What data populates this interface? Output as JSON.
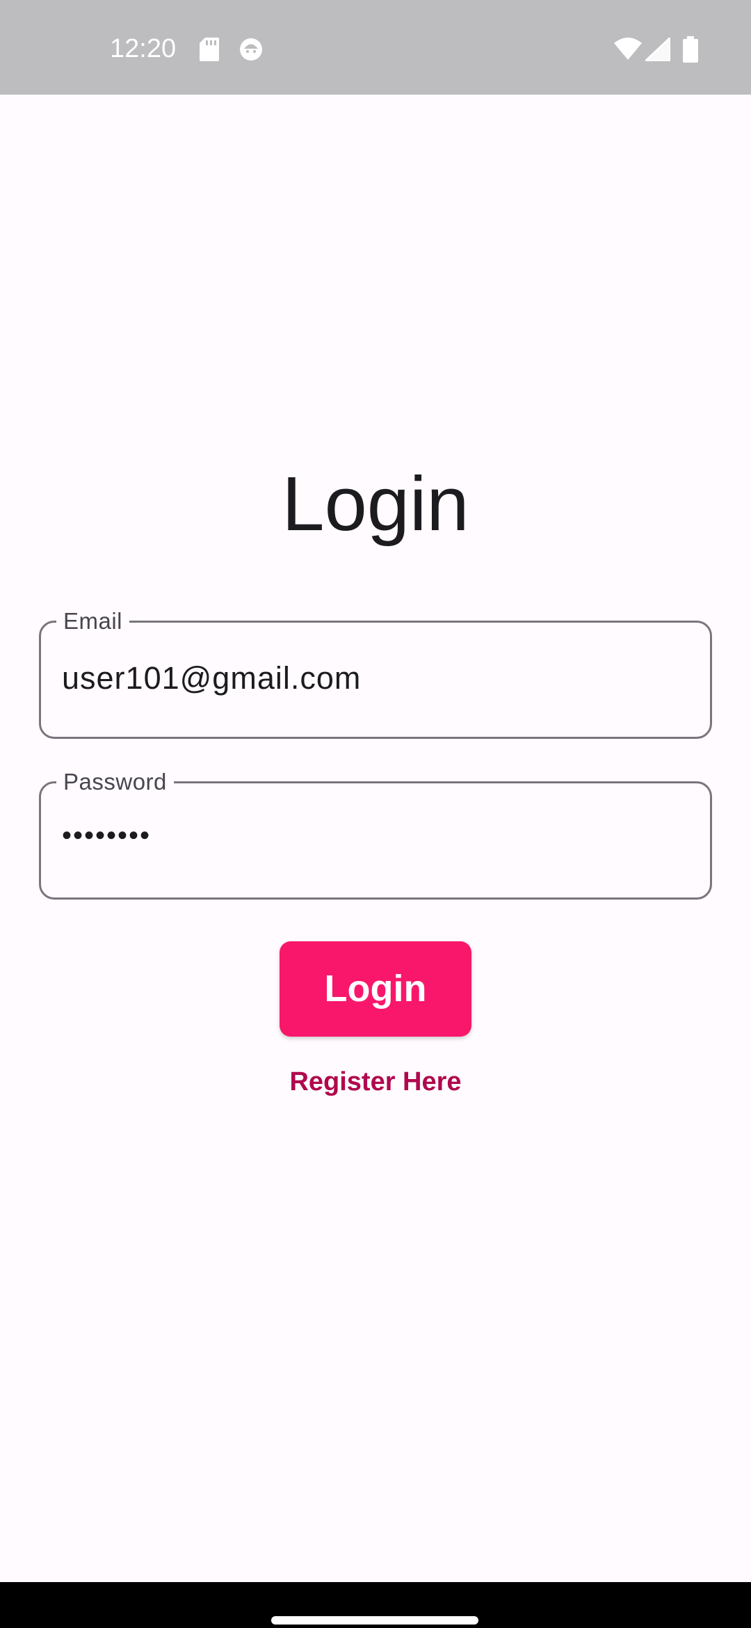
{
  "status_bar": {
    "time": "12:20",
    "icons": [
      "sd-card-icon",
      "face-icon",
      "wifi-icon",
      "signal-icon",
      "battery-icon"
    ]
  },
  "screen": {
    "title": "Login"
  },
  "form": {
    "email": {
      "label": "Email",
      "value": "user101@gmail.com"
    },
    "password": {
      "label": "Password",
      "value": "••••••••"
    },
    "login_button": "Login",
    "register_link": "Register Here"
  },
  "colors": {
    "primary": "#f8176b",
    "link": "#b0084e",
    "background": "#fffbfe",
    "status_bar": "#bdbcbe"
  }
}
